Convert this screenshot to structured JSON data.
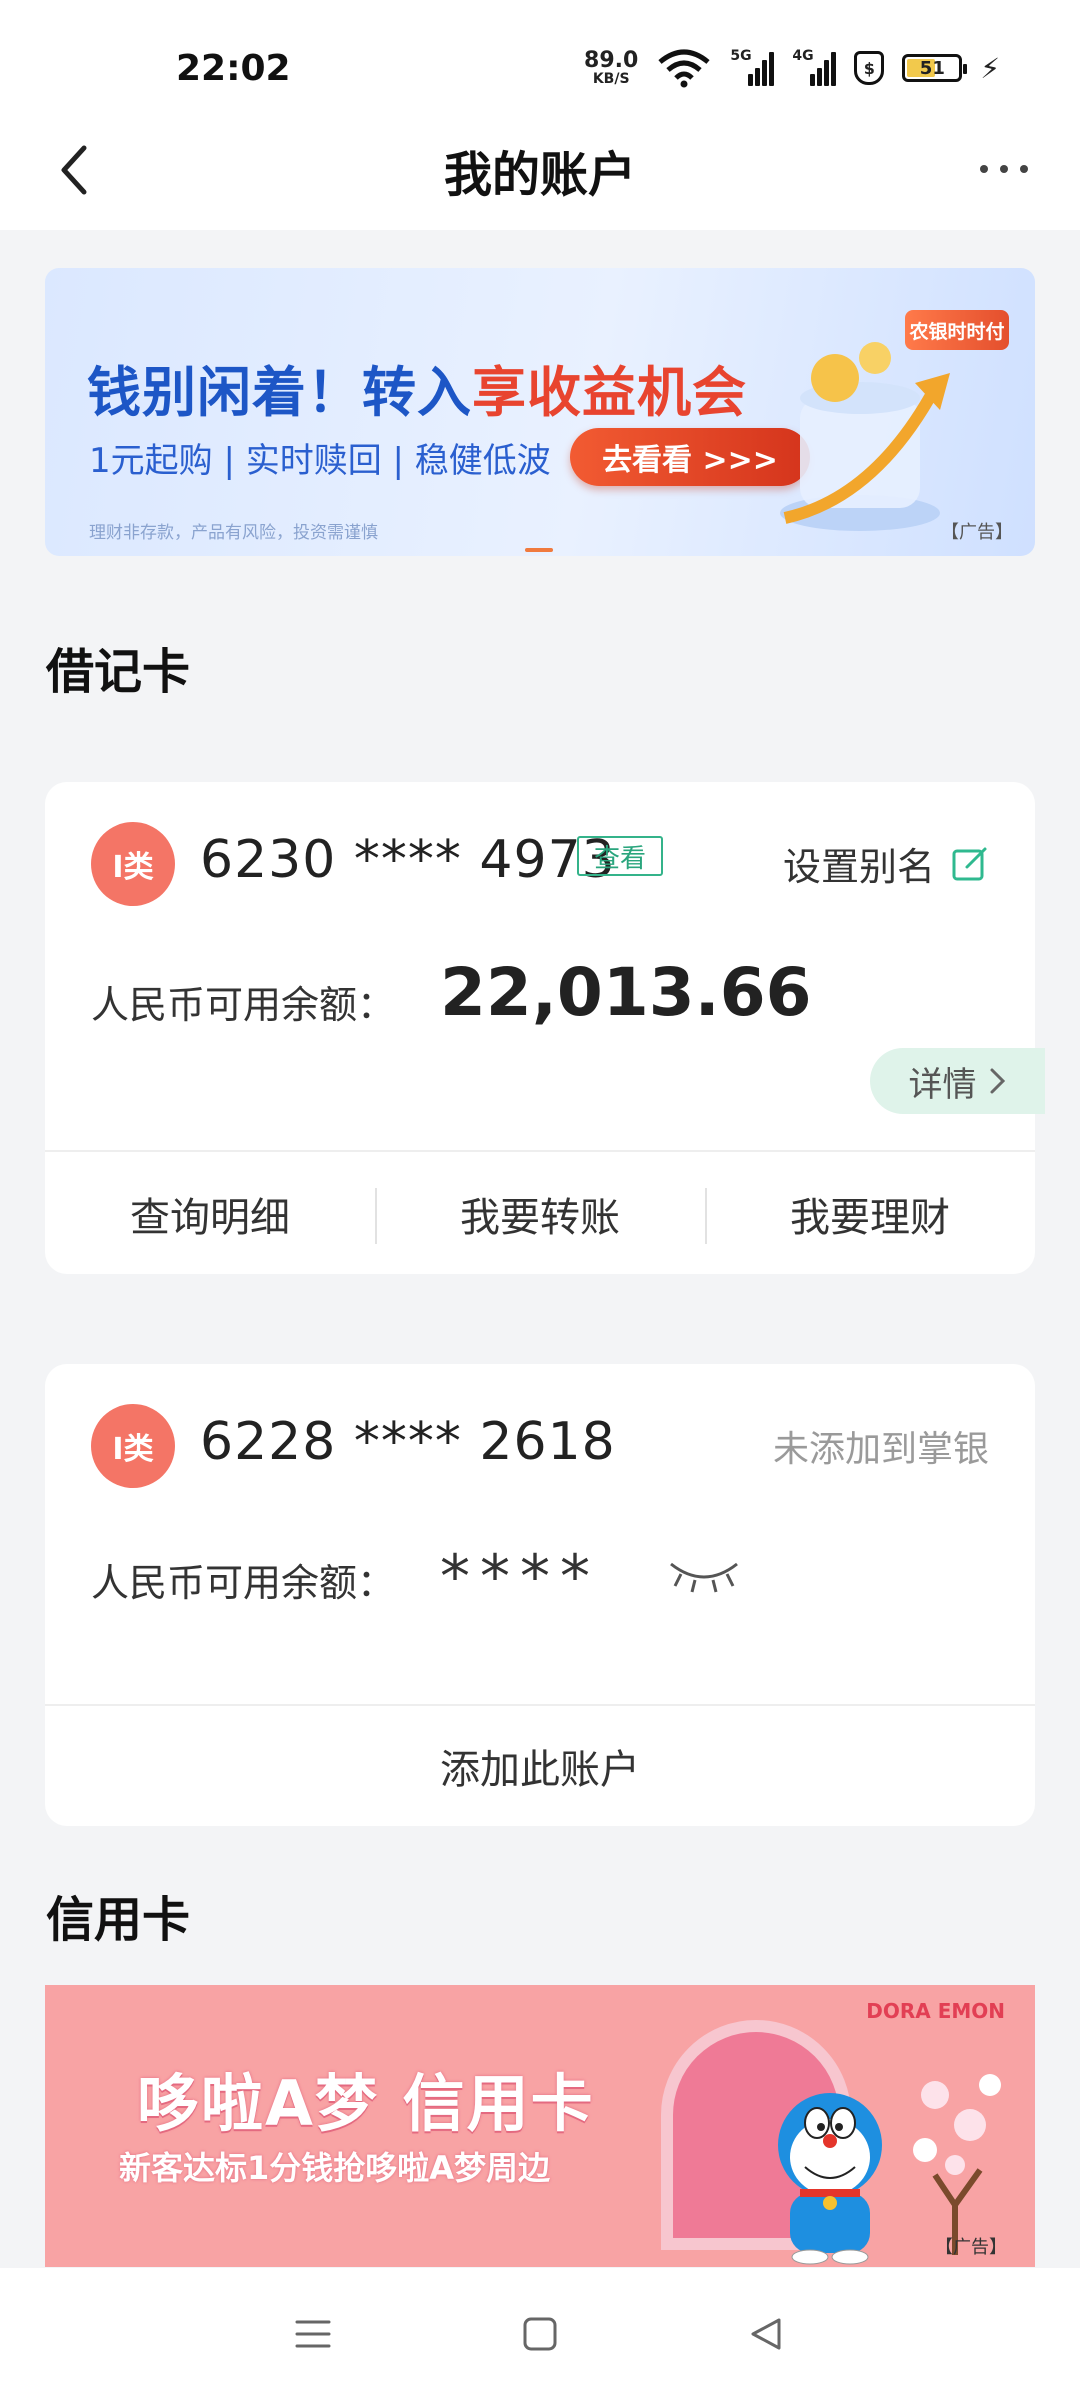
{
  "status_bar": {
    "time": "22:02",
    "net_speed_value": "89.0",
    "net_speed_unit": "KB/S",
    "signal_1_label": "5G",
    "signal_2_label": "4G",
    "battery_level": "51",
    "battery_percent_fill": 0.51
  },
  "header": {
    "title": "我的账户",
    "back_icon": "chevron-left-icon",
    "more_icon": "more-horizontal-icon"
  },
  "banner": {
    "headline_part1": "钱别闲着！转入",
    "headline_part2": "享收益机会",
    "subtitle": "1元起购 | 实时赎回 | 稳健低波",
    "cta_label": "去看看 >>>",
    "disclaimer": "理财非存款，产品有风险，投资需谨慎",
    "tag": "农银时时付",
    "ad_label": "【广告】",
    "accent_color": "#1d56c6",
    "highlight_color": "#e8442f"
  },
  "debit_section": {
    "title": "借记卡"
  },
  "card1": {
    "badge": "I类",
    "number": "6230 **** 4973",
    "view_label": "查看",
    "alias_label": "设置别名",
    "balance_label": "人民币可用余额：",
    "balance_value": "22,013.66",
    "detail_label": "详情",
    "actions": [
      "查询明细",
      "我要转账",
      "我要理财"
    ]
  },
  "card2": {
    "badge": "I类",
    "number": "6228 **** 2618",
    "status": "未添加到掌银",
    "balance_label": "人民币可用余额：",
    "balance_masked": "****",
    "add_label": "添加此账户"
  },
  "credit_section": {
    "title": "信用卡"
  },
  "cc_banner": {
    "title": "哆啦A梦 信用卡",
    "subtitle": "新客达标1分钱抢哆啦A梦周边",
    "brand": "DORA EMON",
    "ad_label": "【广告】"
  },
  "navbar": {
    "menu_icon": "menu-icon",
    "home_icon": "home-square-icon",
    "back_icon": "back-triangle-icon"
  }
}
